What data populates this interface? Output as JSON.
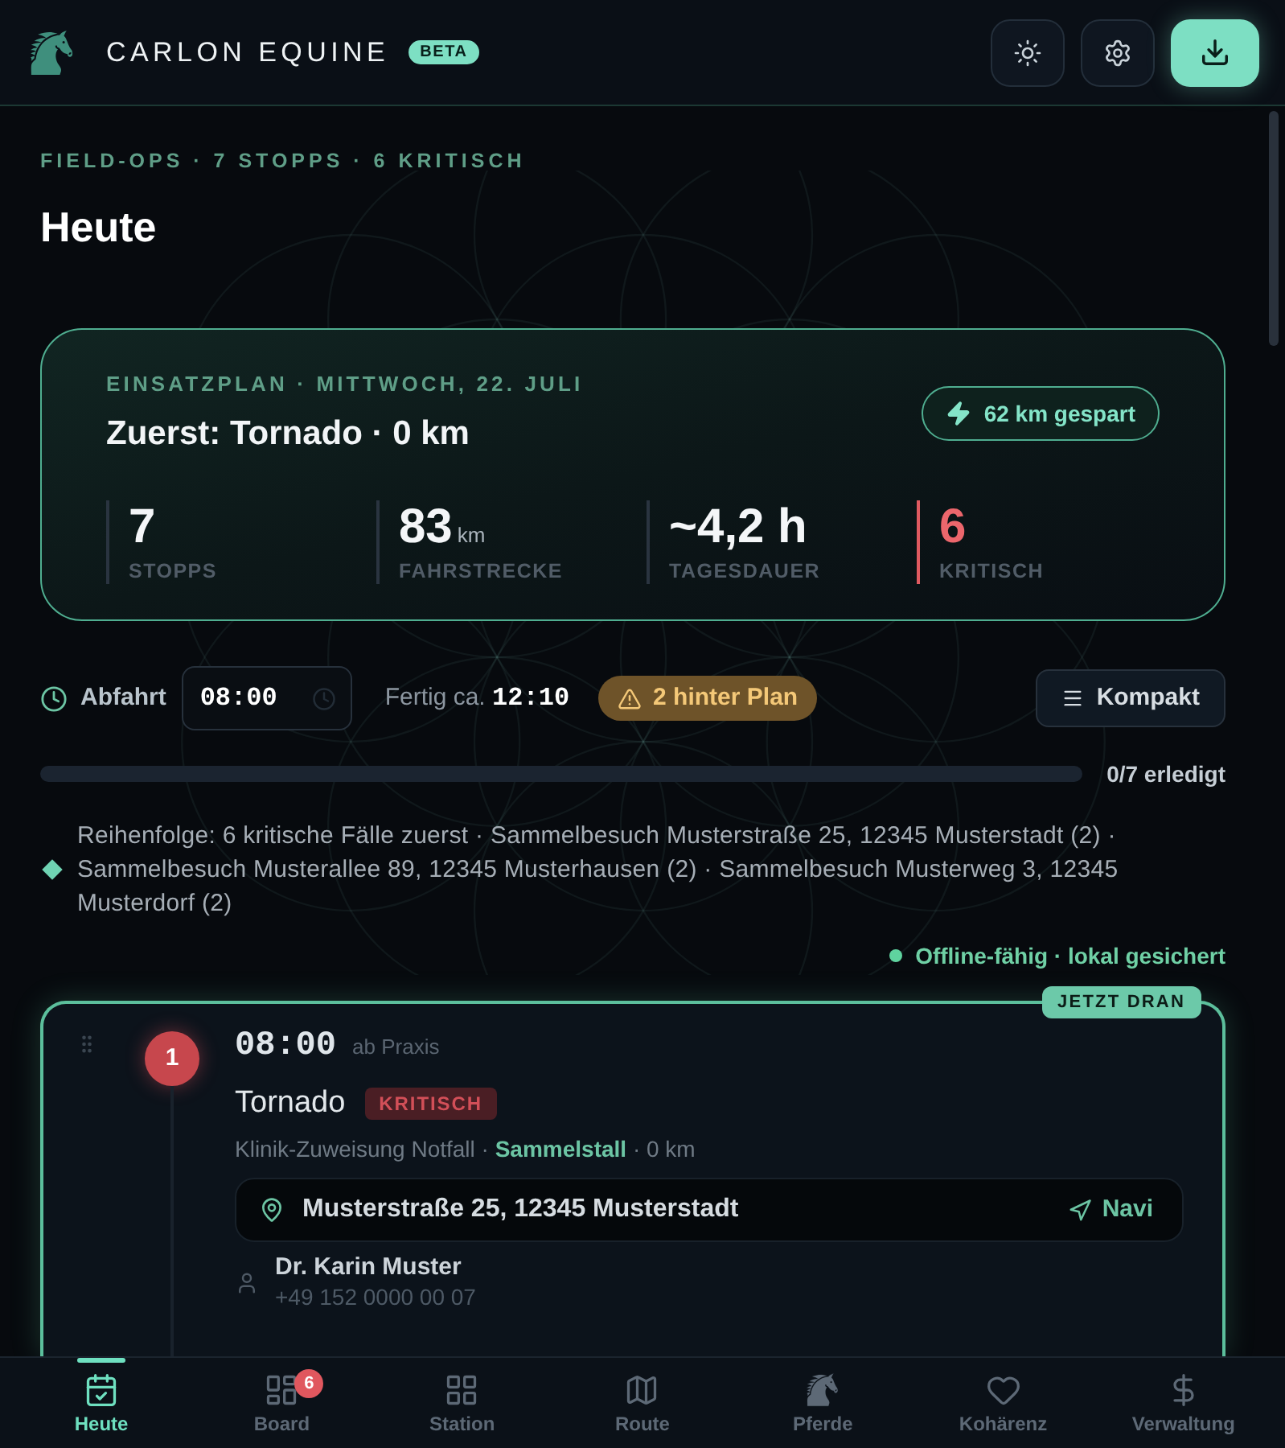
{
  "header": {
    "brand": "CARLON EQUINE",
    "badge": "BETA",
    "toolbar": [
      {
        "kind": "theme"
      },
      {
        "kind": "settings"
      },
      {
        "kind": "download"
      }
    ]
  },
  "page": {
    "eyebrow": "FIELD-OPS · 7 STOPPS · 6 KRITISCH",
    "title": "Heute"
  },
  "plan_card": {
    "eyebrow": "EINSATZPLAN · MITTWOCH, 22. JULI",
    "headline": "Zuerst: Tornado · 0 km",
    "savings": "62 km gespart",
    "stats": [
      {
        "value": "7",
        "label": "STOPPS",
        "critical": false
      },
      {
        "value": "83",
        "unit": "km",
        "label": "FAHRSTRECKE",
        "critical": false
      },
      {
        "value": "~4,2 h",
        "label": "TAGESDAUER",
        "critical": false
      },
      {
        "value": "6",
        "label": "KRITISCH",
        "critical": true
      }
    ]
  },
  "schedule": {
    "departure_label": "Abfahrt",
    "departure_time": "08:00",
    "finish_label": "Fertig ca.",
    "finish_time": "12:10",
    "delay": "2 hinter Plan",
    "view_button": "Kompakt"
  },
  "progress": {
    "label": "0/7 erledigt"
  },
  "sequence_note": "Reihenfolge: 6 kritische Fälle zuerst · Sammelbesuch Musterstraße 25, 12345 Musterstadt (2) · Sammelbesuch Musterallee 89, 12345 Musterhausen (2) · Sammelbesuch Musterweg 3, 12345 Musterdorf (2)",
  "sync_status": "Offline-fähig · lokal gesichert",
  "stops": [
    {
      "number": "1",
      "time": "08:00",
      "origin": "ab Praxis",
      "horse": "Tornado",
      "tag": "KRITISCH",
      "critical": true,
      "current": true,
      "current_label": "JETZT DRAN",
      "details": "Klinik-Zuweisung Notfall · **Sammelstall** · 0 km",
      "address": "Musterstraße 25, 12345 Musterstadt",
      "navi": "Navi",
      "contact_name": "Dr. Karin Muster",
      "contact_phone": "+49 152 0000 00 07"
    }
  ],
  "bottom_nav": [
    {
      "kind": "today",
      "label": "Heute",
      "selected": true
    },
    {
      "kind": "board",
      "label": "Board",
      "selected": false,
      "badge": "6"
    },
    {
      "kind": "station",
      "label": "Station",
      "selected": false
    },
    {
      "kind": "route",
      "label": "Route",
      "selected": false
    },
    {
      "kind": "horses",
      "label": "Pferde",
      "selected": false
    },
    {
      "kind": "coherence",
      "label": "Kohärenz",
      "selected": false
    },
    {
      "kind": "admin",
      "label": "Verwaltung",
      "selected": false
    }
  ]
}
